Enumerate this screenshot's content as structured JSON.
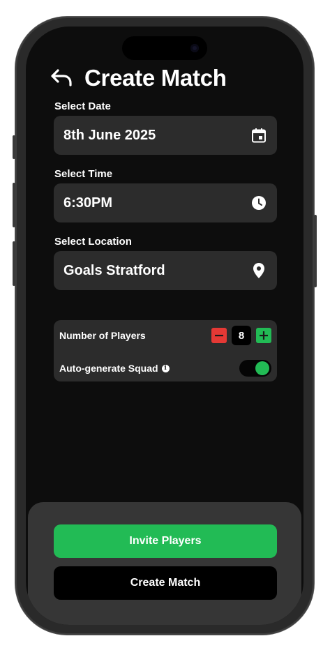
{
  "header": {
    "title": "Create Match",
    "back_icon": "back-arrow-icon"
  },
  "fields": {
    "date": {
      "label": "Select Date",
      "value": "8th June 2025",
      "icon": "calendar-icon"
    },
    "time": {
      "label": "Select Time",
      "value": "6:30PM",
      "icon": "clock-icon"
    },
    "location": {
      "label": "Select Location",
      "value": "Goals Stratford",
      "icon": "location-pin-icon"
    }
  },
  "options": {
    "players": {
      "label": "Number of Players",
      "value": "8",
      "decrement_icon": "minus-icon",
      "increment_icon": "plus-icon"
    },
    "auto_squad": {
      "label": "Auto-generate Squad",
      "info_glyph": "i",
      "enabled": true
    }
  },
  "actions": {
    "invite_label": "Invite Players",
    "create_label": "Create Match"
  },
  "colors": {
    "background": "#0d0d0d",
    "surface": "#2c2c2c",
    "sheet": "#363636",
    "accent_green": "#22bb55",
    "danger_red": "#e53935",
    "text": "#ffffff"
  }
}
